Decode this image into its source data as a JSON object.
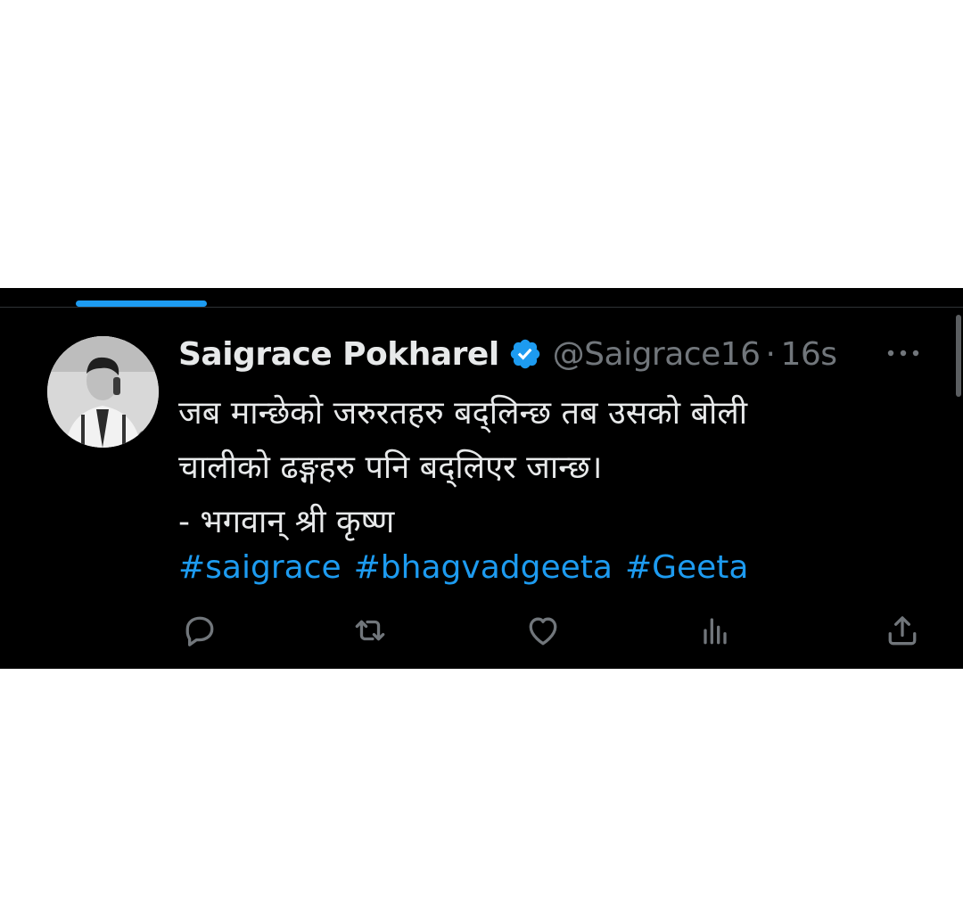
{
  "tweet": {
    "display_name": "Saigrace Pokharel",
    "handle": "@Saigrace16",
    "separator": "·",
    "timestamp": "16s",
    "text_lines": [
      "जब मान्छेको जरुरतहरु बद्लिन्छ तब उसको बोली",
      "चालीको ढङ्गहरु पनि बद्लिएर जान्छ।",
      "- भगवान् श्री कृष्ण"
    ],
    "hashtags": [
      "#saigrace",
      "#bhagvadgeeta",
      "#Geeta"
    ]
  },
  "icons": {
    "verified": "verified-badge-icon",
    "more": "more-options-icon",
    "reply": "reply-icon",
    "retweet": "retweet-icon",
    "like": "like-icon",
    "views": "views-icon",
    "share": "share-icon"
  },
  "colors": {
    "background": "#000000",
    "accent": "#1d9bf0",
    "text_primary": "#e7e9ea",
    "text_secondary": "#71767b"
  }
}
